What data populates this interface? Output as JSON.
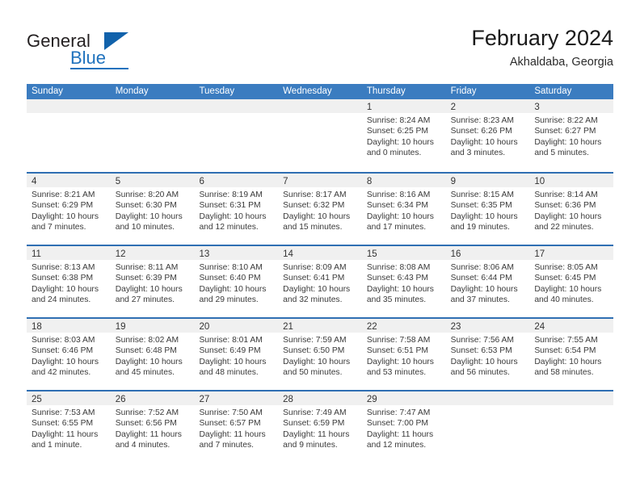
{
  "brand": {
    "name_top": "General",
    "name_bottom": "Blue",
    "accent_color": "#1f72bd",
    "triangle_color": "#1162ab"
  },
  "header": {
    "month_title": "February 2024",
    "location": "Akhaldaba, Georgia"
  },
  "calendar": {
    "header_color": "#3b7cc0",
    "weekday_headers": [
      "Sunday",
      "Monday",
      "Tuesday",
      "Wednesday",
      "Thursday",
      "Friday",
      "Saturday"
    ],
    "weeks": [
      [
        {
          "day": "",
          "empty": true
        },
        {
          "day": "",
          "empty": true
        },
        {
          "day": "",
          "empty": true
        },
        {
          "day": "",
          "empty": true
        },
        {
          "day": "1",
          "sunrise": "Sunrise: 8:24 AM",
          "sunset": "Sunset: 6:25 PM",
          "daylight_1": "Daylight: 10 hours",
          "daylight_2": "and 0 minutes."
        },
        {
          "day": "2",
          "sunrise": "Sunrise: 8:23 AM",
          "sunset": "Sunset: 6:26 PM",
          "daylight_1": "Daylight: 10 hours",
          "daylight_2": "and 3 minutes."
        },
        {
          "day": "3",
          "sunrise": "Sunrise: 8:22 AM",
          "sunset": "Sunset: 6:27 PM",
          "daylight_1": "Daylight: 10 hours",
          "daylight_2": "and 5 minutes."
        }
      ],
      [
        {
          "day": "4",
          "sunrise": "Sunrise: 8:21 AM",
          "sunset": "Sunset: 6:29 PM",
          "daylight_1": "Daylight: 10 hours",
          "daylight_2": "and 7 minutes."
        },
        {
          "day": "5",
          "sunrise": "Sunrise: 8:20 AM",
          "sunset": "Sunset: 6:30 PM",
          "daylight_1": "Daylight: 10 hours",
          "daylight_2": "and 10 minutes."
        },
        {
          "day": "6",
          "sunrise": "Sunrise: 8:19 AM",
          "sunset": "Sunset: 6:31 PM",
          "daylight_1": "Daylight: 10 hours",
          "daylight_2": "and 12 minutes."
        },
        {
          "day": "7",
          "sunrise": "Sunrise: 8:17 AM",
          "sunset": "Sunset: 6:32 PM",
          "daylight_1": "Daylight: 10 hours",
          "daylight_2": "and 15 minutes."
        },
        {
          "day": "8",
          "sunrise": "Sunrise: 8:16 AM",
          "sunset": "Sunset: 6:34 PM",
          "daylight_1": "Daylight: 10 hours",
          "daylight_2": "and 17 minutes."
        },
        {
          "day": "9",
          "sunrise": "Sunrise: 8:15 AM",
          "sunset": "Sunset: 6:35 PM",
          "daylight_1": "Daylight: 10 hours",
          "daylight_2": "and 19 minutes."
        },
        {
          "day": "10",
          "sunrise": "Sunrise: 8:14 AM",
          "sunset": "Sunset: 6:36 PM",
          "daylight_1": "Daylight: 10 hours",
          "daylight_2": "and 22 minutes."
        }
      ],
      [
        {
          "day": "11",
          "sunrise": "Sunrise: 8:13 AM",
          "sunset": "Sunset: 6:38 PM",
          "daylight_1": "Daylight: 10 hours",
          "daylight_2": "and 24 minutes."
        },
        {
          "day": "12",
          "sunrise": "Sunrise: 8:11 AM",
          "sunset": "Sunset: 6:39 PM",
          "daylight_1": "Daylight: 10 hours",
          "daylight_2": "and 27 minutes."
        },
        {
          "day": "13",
          "sunrise": "Sunrise: 8:10 AM",
          "sunset": "Sunset: 6:40 PM",
          "daylight_1": "Daylight: 10 hours",
          "daylight_2": "and 29 minutes."
        },
        {
          "day": "14",
          "sunrise": "Sunrise: 8:09 AM",
          "sunset": "Sunset: 6:41 PM",
          "daylight_1": "Daylight: 10 hours",
          "daylight_2": "and 32 minutes."
        },
        {
          "day": "15",
          "sunrise": "Sunrise: 8:08 AM",
          "sunset": "Sunset: 6:43 PM",
          "daylight_1": "Daylight: 10 hours",
          "daylight_2": "and 35 minutes."
        },
        {
          "day": "16",
          "sunrise": "Sunrise: 8:06 AM",
          "sunset": "Sunset: 6:44 PM",
          "daylight_1": "Daylight: 10 hours",
          "daylight_2": "and 37 minutes."
        },
        {
          "day": "17",
          "sunrise": "Sunrise: 8:05 AM",
          "sunset": "Sunset: 6:45 PM",
          "daylight_1": "Daylight: 10 hours",
          "daylight_2": "and 40 minutes."
        }
      ],
      [
        {
          "day": "18",
          "sunrise": "Sunrise: 8:03 AM",
          "sunset": "Sunset: 6:46 PM",
          "daylight_1": "Daylight: 10 hours",
          "daylight_2": "and 42 minutes."
        },
        {
          "day": "19",
          "sunrise": "Sunrise: 8:02 AM",
          "sunset": "Sunset: 6:48 PM",
          "daylight_1": "Daylight: 10 hours",
          "daylight_2": "and 45 minutes."
        },
        {
          "day": "20",
          "sunrise": "Sunrise: 8:01 AM",
          "sunset": "Sunset: 6:49 PM",
          "daylight_1": "Daylight: 10 hours",
          "daylight_2": "and 48 minutes."
        },
        {
          "day": "21",
          "sunrise": "Sunrise: 7:59 AM",
          "sunset": "Sunset: 6:50 PM",
          "daylight_1": "Daylight: 10 hours",
          "daylight_2": "and 50 minutes."
        },
        {
          "day": "22",
          "sunrise": "Sunrise: 7:58 AM",
          "sunset": "Sunset: 6:51 PM",
          "daylight_1": "Daylight: 10 hours",
          "daylight_2": "and 53 minutes."
        },
        {
          "day": "23",
          "sunrise": "Sunrise: 7:56 AM",
          "sunset": "Sunset: 6:53 PM",
          "daylight_1": "Daylight: 10 hours",
          "daylight_2": "and 56 minutes."
        },
        {
          "day": "24",
          "sunrise": "Sunrise: 7:55 AM",
          "sunset": "Sunset: 6:54 PM",
          "daylight_1": "Daylight: 10 hours",
          "daylight_2": "and 58 minutes."
        }
      ],
      [
        {
          "day": "25",
          "sunrise": "Sunrise: 7:53 AM",
          "sunset": "Sunset: 6:55 PM",
          "daylight_1": "Daylight: 11 hours",
          "daylight_2": "and 1 minute."
        },
        {
          "day": "26",
          "sunrise": "Sunrise: 7:52 AM",
          "sunset": "Sunset: 6:56 PM",
          "daylight_1": "Daylight: 11 hours",
          "daylight_2": "and 4 minutes."
        },
        {
          "day": "27",
          "sunrise": "Sunrise: 7:50 AM",
          "sunset": "Sunset: 6:57 PM",
          "daylight_1": "Daylight: 11 hours",
          "daylight_2": "and 7 minutes."
        },
        {
          "day": "28",
          "sunrise": "Sunrise: 7:49 AM",
          "sunset": "Sunset: 6:59 PM",
          "daylight_1": "Daylight: 11 hours",
          "daylight_2": "and 9 minutes."
        },
        {
          "day": "29",
          "sunrise": "Sunrise: 7:47 AM",
          "sunset": "Sunset: 7:00 PM",
          "daylight_1": "Daylight: 11 hours",
          "daylight_2": "and 12 minutes."
        },
        {
          "day": "",
          "empty": true
        },
        {
          "day": "",
          "empty": true
        }
      ]
    ]
  }
}
